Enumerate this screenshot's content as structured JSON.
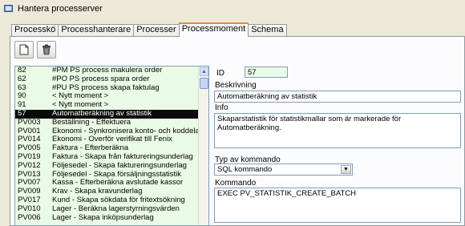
{
  "window": {
    "title": "Hantera processerver"
  },
  "tabs": [
    {
      "label": "Processkö"
    },
    {
      "label": "Processhanterare"
    },
    {
      "label": "Processer"
    },
    {
      "label": "Processmoment"
    },
    {
      "label": "Schema"
    }
  ],
  "toolbar": {
    "new_icon": "new-document-icon",
    "delete_icon": "trash-icon"
  },
  "list": {
    "rows": [
      {
        "id": "82",
        "name": "#PM PS process makulera order"
      },
      {
        "id": "62",
        "name": "#PO PS process spara order"
      },
      {
        "id": "63",
        "name": "#PU PS process skapa faktulag"
      },
      {
        "id": "90",
        "name": "< Nytt moment >"
      },
      {
        "id": "91",
        "name": "< Nytt moment >"
      },
      {
        "id": "57",
        "name": "Automatberäkning av statistik"
      },
      {
        "id": "PV003",
        "name": "Beställning - Effektuera"
      },
      {
        "id": "PV001",
        "name": "Ekonomi - Synkronisera konto- och koddelar"
      },
      {
        "id": "PV014",
        "name": "Ekonomi - Överför verifikat till Fenix"
      },
      {
        "id": "PV005",
        "name": "Faktura - Efterberäkna"
      },
      {
        "id": "PV019",
        "name": "Faktura - Skapa från faktureringsunderlag"
      },
      {
        "id": "PV012",
        "name": "Följesedel - Skapa faktureringsunderlag"
      },
      {
        "id": "PV013",
        "name": "Följesedel - Skapa försäljningsstatistik"
      },
      {
        "id": "PV007",
        "name": "Kassa - Efterberäkna avslutade kassor"
      },
      {
        "id": "PV009",
        "name": "Krav - Skapa kravunderlag"
      },
      {
        "id": "PV017",
        "name": "Kund - Skapa sökdata för fritextsökning"
      },
      {
        "id": "PV010",
        "name": "Lager - Beräkna lagerstyrningsvärden"
      },
      {
        "id": "PV006",
        "name": "Lager - Skapa inköpsunderlag"
      }
    ],
    "selected_index": 5
  },
  "detail": {
    "id_label": "ID",
    "id_value": "57",
    "description_label": "Beskrivning",
    "description_value": "Automatberäkning av statistik",
    "info_label": "Info",
    "info_value": "Skaparstatistik för statistikmallar som är markerade för Automatberäkning.",
    "command_type_label": "Typ av kommando",
    "command_type_value": "SQL kommando",
    "command_label": "Kommando",
    "command_value": "EXEC PV_STATISTIK_CREATE_BATCH"
  },
  "colors": {
    "list_bg": "#eafbe5",
    "selection": "#0a0a0a",
    "active_tab_accent": "#e68b2c"
  }
}
